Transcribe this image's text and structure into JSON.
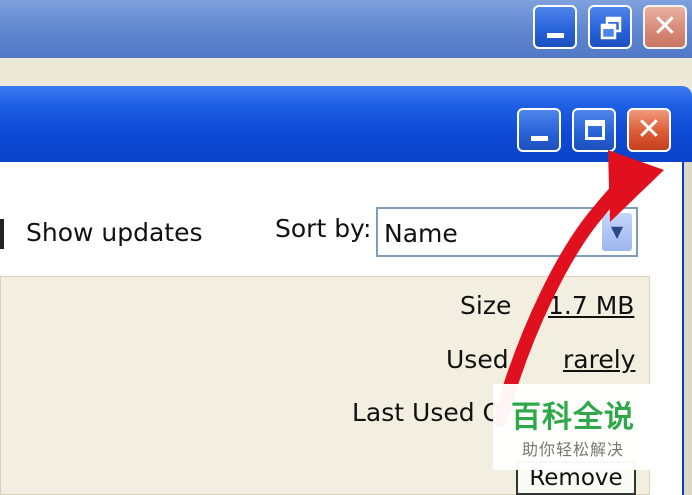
{
  "toolbar": {
    "show_updates_label": "Show updates",
    "sort_by_label": "Sort by:",
    "sort_by_value": "Name"
  },
  "details": {
    "size_label": "Size",
    "size_value": "1.7 MB",
    "used_label": "Used",
    "used_value": "rarely",
    "last_used_label": "Last Used On",
    "remove_label": "Remove"
  },
  "watermark": {
    "title": "百科全说",
    "subtitle": "助你轻松解决"
  },
  "colors": {
    "titlebar_blue": "#0e4bd6",
    "close_red": "#dd5b35",
    "annotation_red": "#e0101e",
    "watermark_green": "#2fa84a"
  },
  "icons": [
    "minimize-icon",
    "maximize-icon",
    "restore-icon",
    "close-icon",
    "dropdown-arrow-icon",
    "annotation-arrow"
  ]
}
